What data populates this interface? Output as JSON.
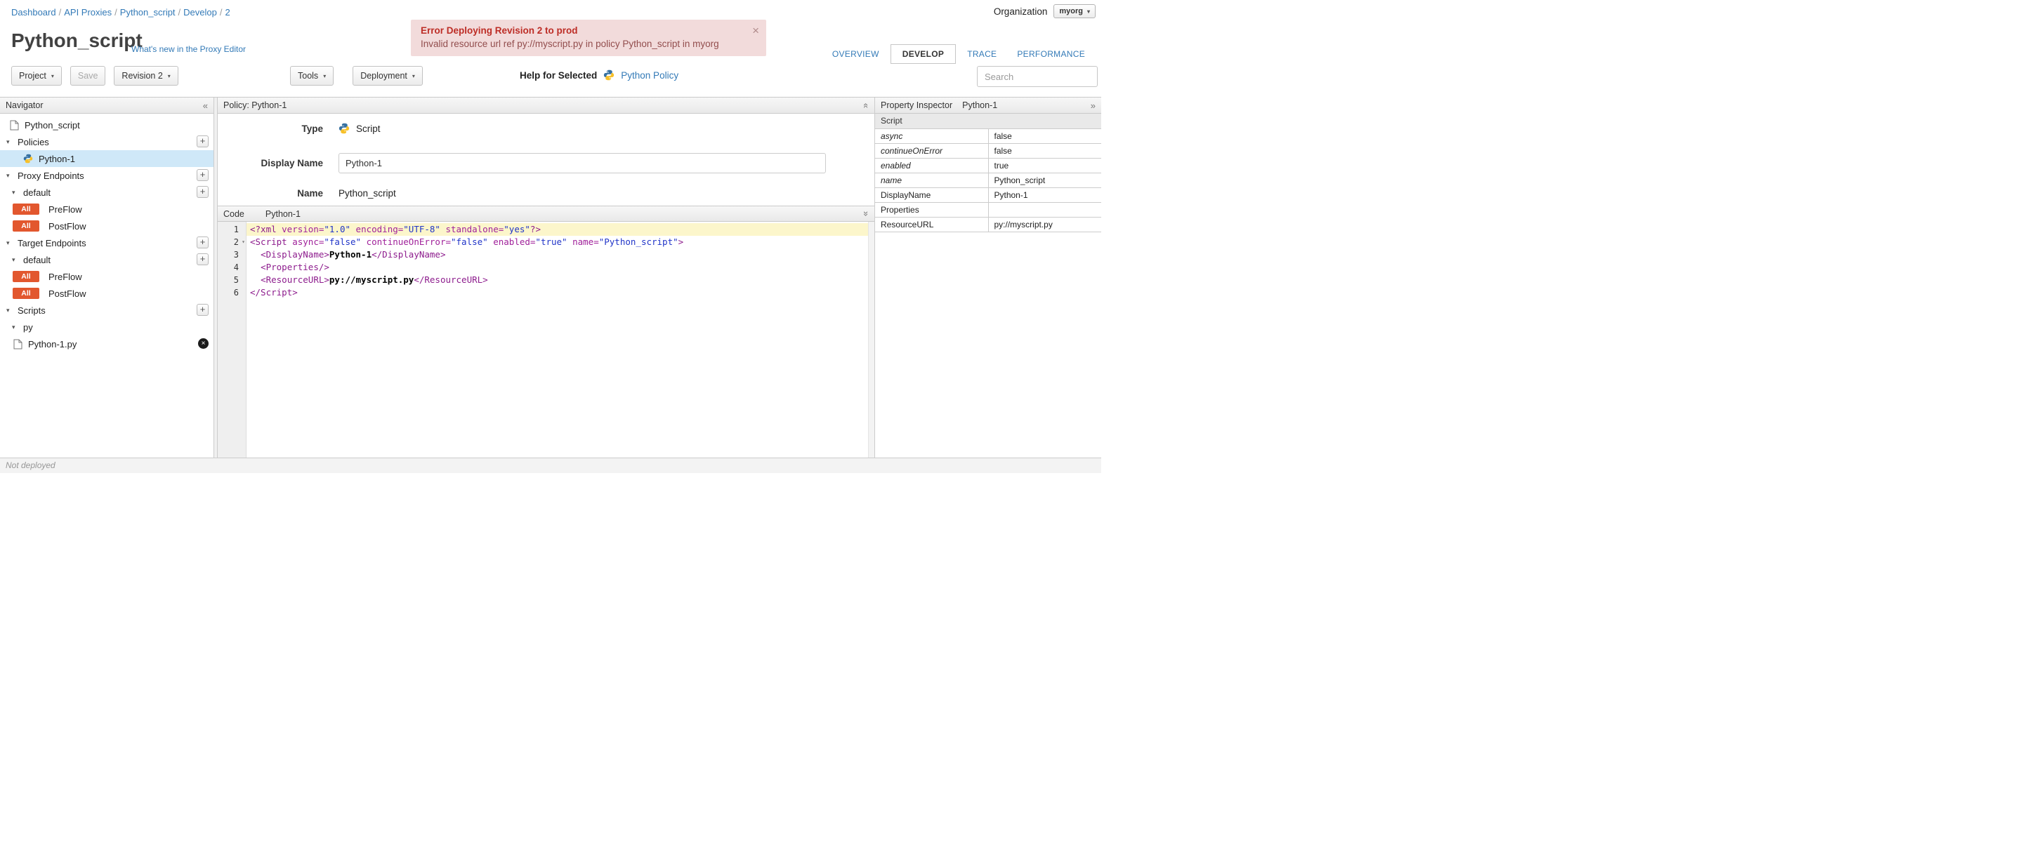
{
  "icons": {
    "caret_down": "▾",
    "triangle_down": "▾",
    "add": "+",
    "collapse_left": "«",
    "expand_right": "»",
    "close": "×",
    "delete": "×"
  },
  "breadcrumb": {
    "separator": "/",
    "items": [
      {
        "label": "Dashboard"
      },
      {
        "label": "API Proxies"
      },
      {
        "label": "Python_script"
      },
      {
        "label": "Develop"
      },
      {
        "label": "2"
      }
    ]
  },
  "organization": {
    "label": "Organization",
    "value": "myorg"
  },
  "error_banner": {
    "title": "Error Deploying Revision 2 to prod",
    "message": "Invalid resource url ref py://myscript.py in policy Python_script in myorg"
  },
  "header": {
    "title": "Python_script",
    "whats_new_link": "What's new in the Proxy Editor"
  },
  "tabs": [
    {
      "label": "OVERVIEW"
    },
    {
      "label": "DEVELOP"
    },
    {
      "label": "TRACE"
    },
    {
      "label": "PERFORMANCE"
    }
  ],
  "toolbar": {
    "project": "Project",
    "save": "Save",
    "revision": "Revision 2",
    "tools": "Tools",
    "deployment": "Deployment",
    "help_for_selected": "Help for Selected",
    "help_link": "Python Policy",
    "search_placeholder": "Search"
  },
  "navigator": {
    "title": "Navigator",
    "root_item": "Python_script",
    "policies": {
      "label": "Policies",
      "items": [
        {
          "label": "Python-1"
        }
      ]
    },
    "proxy_endpoints": {
      "label": "Proxy Endpoints",
      "group": {
        "label": "default"
      },
      "flows": [
        {
          "badge": "All",
          "label": "PreFlow"
        },
        {
          "badge": "All",
          "label": "PostFlow"
        }
      ]
    },
    "target_endpoints": {
      "label": "Target Endpoints",
      "group": {
        "label": "default"
      },
      "flows": [
        {
          "badge": "All",
          "label": "PreFlow"
        },
        {
          "badge": "All",
          "label": "PostFlow"
        }
      ]
    },
    "scripts": {
      "label": "Scripts",
      "group": {
        "label": "py"
      },
      "items": [
        {
          "label": "Python-1.py"
        }
      ]
    }
  },
  "policy_editor": {
    "title": "Policy: Python-1",
    "type_label": "Type",
    "type_value": "Script",
    "display_name_label": "Display Name",
    "display_name_value": "Python-1",
    "name_label": "Name",
    "name_value": "Python_script"
  },
  "code_editor": {
    "label": "Code",
    "file": "Python-1",
    "lines": [
      {
        "number": 1,
        "active": true,
        "tokens": [
          [
            "tag",
            "<?xml "
          ],
          [
            "attr",
            "version="
          ],
          [
            "str",
            "\"1.0\""
          ],
          [
            "attr",
            " encoding="
          ],
          [
            "str",
            "\"UTF-8\""
          ],
          [
            "attr",
            " standalone="
          ],
          [
            "str",
            "\"yes\""
          ],
          [
            "tag",
            "?>"
          ]
        ]
      },
      {
        "number": 2,
        "fold": true,
        "tokens": [
          [
            "tag",
            "<Script "
          ],
          [
            "attr",
            "async="
          ],
          [
            "str",
            "\"false\""
          ],
          [
            "attr",
            " continueOnError="
          ],
          [
            "str",
            "\"false\""
          ],
          [
            "attr",
            " enabled="
          ],
          [
            "str",
            "\"true\""
          ],
          [
            "attr",
            " name="
          ],
          [
            "str",
            "\"Python_script\""
          ],
          [
            "tag",
            ">"
          ]
        ]
      },
      {
        "number": 3,
        "tokens": [
          [
            "plain",
            "  "
          ],
          [
            "tag",
            "<DisplayName>"
          ],
          [
            "text",
            "Python-1"
          ],
          [
            "tag",
            "</DisplayName>"
          ]
        ]
      },
      {
        "number": 4,
        "tokens": [
          [
            "plain",
            "  "
          ],
          [
            "tag",
            "<Properties/>"
          ]
        ]
      },
      {
        "number": 5,
        "tokens": [
          [
            "plain",
            "  "
          ],
          [
            "tag",
            "<ResourceURL>"
          ],
          [
            "text",
            "py://myscript.py"
          ],
          [
            "tag",
            "</ResourceURL>"
          ]
        ]
      },
      {
        "number": 6,
        "tokens": [
          [
            "tag",
            "</Script>"
          ]
        ]
      }
    ]
  },
  "property_inspector": {
    "title": "Property Inspector",
    "subtitle": "Python-1",
    "section": "Script",
    "rows": [
      {
        "key": "async",
        "value": "false"
      },
      {
        "key": "continueOnError",
        "value": "false"
      },
      {
        "key": "enabled",
        "value": "true"
      },
      {
        "key": "name",
        "value": "Python_script"
      },
      {
        "key": "DisplayName",
        "value": "Python-1"
      },
      {
        "key": "Properties",
        "value": ""
      },
      {
        "key": "ResourceURL",
        "value": "py://myscript.py"
      }
    ]
  },
  "statusbar": {
    "text": "Not deployed"
  }
}
